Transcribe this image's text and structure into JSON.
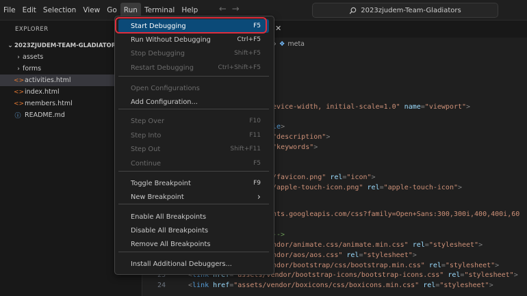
{
  "menubar": {
    "items": [
      "File",
      "Edit",
      "Selection",
      "View",
      "Go",
      "Run",
      "Terminal",
      "Help"
    ],
    "active": "Run"
  },
  "search": {
    "text": "2023zjudem-Team-Gladiators"
  },
  "sidebar": {
    "title": "EXPLORER",
    "root": "2023ZJUDEM-TEAM-GLADIATORS",
    "folders": [
      "assets",
      "forms"
    ],
    "files": [
      "activities.html",
      "index.html",
      "members.html",
      "README.md"
    ],
    "selected": "activities.html"
  },
  "editor": {
    "breadcrumb_symbol": "meta",
    "lines": [
      {
        "num": "",
        "parts": [
          [
            "pun",
            ">"
          ]
        ]
      },
      {
        "num": "",
        "parts": [
          [
            "str",
            "device-width, initial-scale=1.0\""
          ],
          [
            "attr",
            " name"
          ],
          [
            "pun",
            "="
          ],
          [
            "str",
            "\"viewport\""
          ],
          [
            "pun",
            ">"
          ]
        ]
      },
      {
        "num": "",
        "parts": [
          [
            "tag",
            "tle"
          ],
          [
            "pun",
            ">"
          ]
        ]
      },
      {
        "num": "",
        "parts": [
          [
            "pun",
            "="
          ],
          [
            "str",
            "\"description\""
          ],
          [
            "pun",
            ">"
          ]
        ]
      },
      {
        "num": "",
        "parts": [
          [
            "pun",
            "="
          ],
          [
            "str",
            "\"keywords\""
          ],
          [
            "pun",
            ">"
          ]
        ]
      },
      {
        "num": "",
        "parts": [
          [
            "str",
            "g/favicon.png\""
          ],
          [
            "attr",
            " rel"
          ],
          [
            "pun",
            "="
          ],
          [
            "str",
            "\"icon\""
          ],
          [
            "pun",
            ">"
          ]
        ]
      },
      {
        "num": "",
        "parts": [
          [
            "str",
            "g/apple-touch-icon.png\""
          ],
          [
            "attr",
            " rel"
          ],
          [
            "pun",
            "="
          ],
          [
            "str",
            "\"apple-touch-icon\""
          ],
          [
            "pun",
            ">"
          ]
        ]
      },
      {
        "num": "",
        "parts": [
          [
            "str",
            "onts.googleapis.com/css?family=Open+Sans:300,300i,400,400i,60"
          ]
        ]
      },
      {
        "num": "",
        "parts": [
          [
            "cmt",
            " -->"
          ]
        ]
      },
      {
        "num": "",
        "parts": [
          [
            "str",
            "endor/animate.css/animate.min.css\""
          ],
          [
            "attr",
            " rel"
          ],
          [
            "pun",
            "="
          ],
          [
            "str",
            "\"stylesheet\""
          ],
          [
            "pun",
            ">"
          ]
        ]
      },
      {
        "num": "",
        "parts": [
          [
            "str",
            "endor/aos/aos.css\""
          ],
          [
            "attr",
            " rel"
          ],
          [
            "pun",
            "="
          ],
          [
            "str",
            "\"stylesheet\""
          ],
          [
            "pun",
            ">"
          ]
        ]
      },
      {
        "num": "",
        "parts": [
          [
            "str",
            "endor/bootstrap/css/bootstrap.min.css\""
          ],
          [
            "attr",
            " rel"
          ],
          [
            "pun",
            "="
          ],
          [
            "str",
            "\"stylesheet\""
          ],
          [
            "pun",
            ">"
          ]
        ]
      },
      {
        "num": "23",
        "parts": [
          [
            "pun",
            "<"
          ],
          [
            "tag",
            "link"
          ],
          [
            "attr",
            " href"
          ],
          [
            "pun",
            "="
          ],
          [
            "str",
            "\"assets/vendor/bootstrap-icons/bootstrap-icons.css\""
          ],
          [
            "attr",
            " rel"
          ],
          [
            "pun",
            "="
          ],
          [
            "str",
            "\"stylesheet\""
          ],
          [
            "pun",
            ">"
          ]
        ]
      },
      {
        "num": "24",
        "parts": [
          [
            "pun",
            "<"
          ],
          [
            "tag",
            "link"
          ],
          [
            "attr",
            " href"
          ],
          [
            "pun",
            "="
          ],
          [
            "str",
            "\"assets/vendor/boxicons/css/boxicons.min.css\""
          ],
          [
            "attr",
            " rel"
          ],
          [
            "pun",
            "="
          ],
          [
            "str",
            "\"stylesheet\""
          ],
          [
            "pun",
            ">"
          ]
        ]
      }
    ]
  },
  "run_menu": {
    "items": [
      {
        "label": "Start Debugging",
        "shortcut": "F5",
        "enabled": true,
        "highlighted": true
      },
      {
        "label": "Run Without Debugging",
        "shortcut": "Ctrl+F5",
        "enabled": true
      },
      {
        "label": "Stop Debugging",
        "shortcut": "Shift+F5",
        "enabled": false
      },
      {
        "label": "Restart Debugging",
        "shortcut": "Ctrl+Shift+F5",
        "enabled": false
      },
      {
        "label": "Open Configurations",
        "shortcut": "",
        "enabled": false
      },
      {
        "label": "Add Configuration...",
        "shortcut": "",
        "enabled": true
      },
      {
        "label": "Step Over",
        "shortcut": "F10",
        "enabled": false
      },
      {
        "label": "Step Into",
        "shortcut": "F11",
        "enabled": false
      },
      {
        "label": "Step Out",
        "shortcut": "Shift+F11",
        "enabled": false
      },
      {
        "label": "Continue",
        "shortcut": "F5",
        "enabled": false
      },
      {
        "label": "Toggle Breakpoint",
        "shortcut": "F9",
        "enabled": true
      },
      {
        "label": "New Breakpoint",
        "shortcut": "",
        "enabled": true,
        "submenu": true
      },
      {
        "label": "Enable All Breakpoints",
        "shortcut": "",
        "enabled": true
      },
      {
        "label": "Disable All Breakpoints",
        "shortcut": "",
        "enabled": true
      },
      {
        "label": "Remove All Breakpoints",
        "shortcut": "",
        "enabled": true
      },
      {
        "label": "Install Additional Debuggers...",
        "shortcut": "",
        "enabled": true
      }
    ],
    "highlight_color": "#0b4a78",
    "callout_color": "#e02d3c"
  }
}
